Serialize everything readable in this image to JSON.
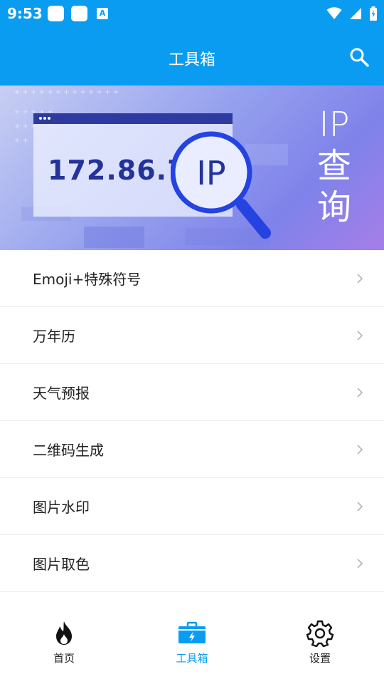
{
  "status_bar": {
    "time": "9:53",
    "notification_icon_letter": "A",
    "icons": [
      "wifi-icon",
      "signal-icon",
      "battery-icon"
    ]
  },
  "app_bar": {
    "title": "工具箱",
    "search_icon": "search-icon"
  },
  "banner": {
    "ip_number": "172.86.79",
    "magnifier_text": "IP",
    "tag_lines": [
      "IP",
      "查",
      "询"
    ]
  },
  "menu": {
    "items": [
      {
        "label": "Emoji+特殊符号"
      },
      {
        "label": "万年历"
      },
      {
        "label": "天气预报"
      },
      {
        "label": "二维码生成"
      },
      {
        "label": "图片水印"
      },
      {
        "label": "图片取色"
      }
    ]
  },
  "tab_bar": {
    "tabs": [
      {
        "label": "首页",
        "icon": "fire-icon",
        "active": false
      },
      {
        "label": "工具箱",
        "icon": "toolbox-icon",
        "active": true
      },
      {
        "label": "设置",
        "icon": "gear-icon",
        "active": false
      }
    ]
  },
  "colors": {
    "primary": "#0a9cf1",
    "banner_dark_blue": "#24339a",
    "text": "#222222"
  }
}
